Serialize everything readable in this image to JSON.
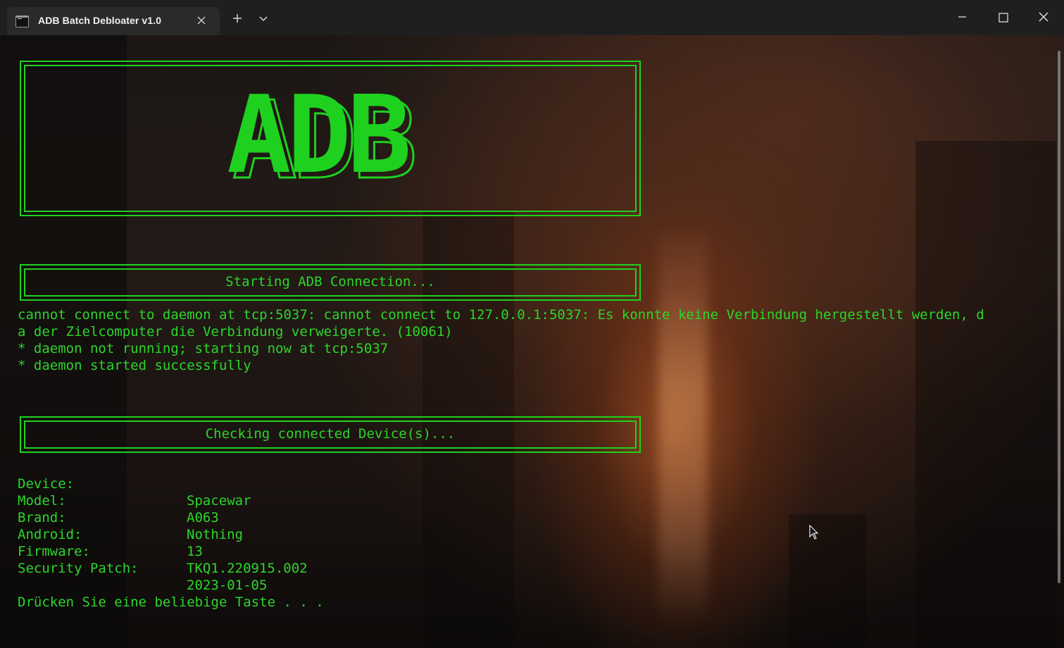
{
  "window": {
    "tab_title": "ADB Batch Debloater v1.0"
  },
  "titlebar": {
    "tab_icon": "terminal-icon",
    "close_tab_icon": "close-icon",
    "new_tab_icon": "plus-icon",
    "dropdown_icon": "chevron-down-icon",
    "minimize_icon": "minimize-icon",
    "maximize_icon": "maximize-icon",
    "close_icon": "close-icon"
  },
  "terminal": {
    "logo_text": "ADB",
    "section1_title": "Starting ADB Connection...",
    "log_lines": [
      "cannot connect to daemon at tcp:5037: cannot connect to 127.0.0.1:5037: Es konnte keine Verbindung hergestellt werden, d",
      "a der Zielcomputer die Verbindung verweigerte. (10061)",
      "* daemon not running; starting now at tcp:5037",
      "* daemon started successfully"
    ],
    "section2_title": "Checking connected Device(s)...",
    "device_info": [
      {
        "key": "Device:",
        "value": "Spacewar"
      },
      {
        "key": "Model:",
        "value": "A063"
      },
      {
        "key": "Brand:",
        "value": "Nothing"
      },
      {
        "key": "Android:",
        "value": "13"
      },
      {
        "key": "Firmware:",
        "value": "TKQ1.220915.002"
      },
      {
        "key": "Security Patch:",
        "value": "2023-01-05"
      }
    ],
    "prompt": "Drücken Sie eine beliebige Taste . . ."
  },
  "colors": {
    "terminal_green": "#2bd62b",
    "titlebar_bg": "#1f1f1f",
    "tab_bg": "#2a2a2a"
  }
}
